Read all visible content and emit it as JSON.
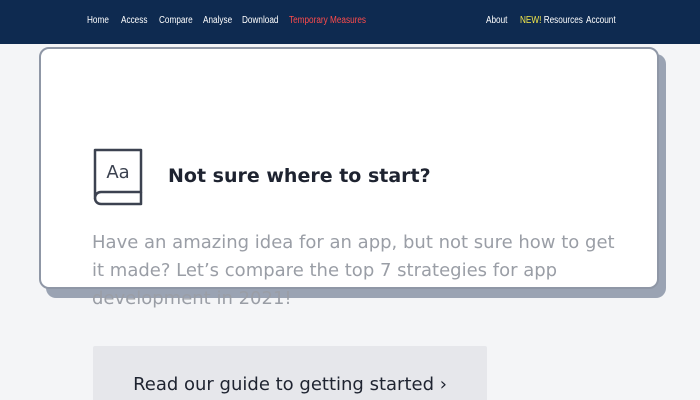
{
  "nav": {
    "left_items": [
      "Home",
      "Access",
      "Compare",
      "Analyse",
      "Download",
      "Temporary Measures"
    ],
    "highlighted_item": "Temporary Measures",
    "about": "About",
    "resources_new": "NEW!",
    "resources": "Resources",
    "account": "Account"
  },
  "card": {
    "icon_text": "Aa",
    "icon": "book-icon",
    "heading": "Not sure where to start?",
    "description": "Have an amazing idea for an app, but not sure how to get it made? Let’s compare the top 7 strategies for app development in 2021!"
  },
  "cta": {
    "label": "Read our guide to getting started ›"
  },
  "colors": {
    "nav_background": "#0e2a50",
    "highlight": "#ff4b4b",
    "new_badge": "#f5e94a",
    "page_background": "#f4f5f7"
  }
}
